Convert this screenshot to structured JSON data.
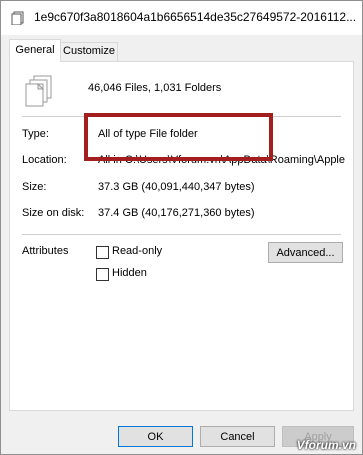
{
  "window": {
    "title": "1e9c670f3a8018604a1b6656514de35c27649572-2016112..."
  },
  "tabs": [
    {
      "label": "General",
      "active": true
    },
    {
      "label": "Customize",
      "active": false
    }
  ],
  "general": {
    "summary": "46,046 Files, 1,031 Folders",
    "type_label": "Type:",
    "type_value": "All of type File folder",
    "location_label": "Location:",
    "location_value": "All in C:\\Users\\Vforum.vn\\AppData\\Roaming\\Apple",
    "size_label": "Size:",
    "size_value": "37.3 GB (40,091,440,347 bytes)",
    "size_on_disk_label": "Size on disk:",
    "size_on_disk_value": "37.4 GB (40,176,271,360 bytes)",
    "attributes_label": "Attributes",
    "readonly_label": "Read-only",
    "hidden_label": "Hidden",
    "advanced_label": "Advanced..."
  },
  "buttons": {
    "ok": "OK",
    "cancel": "Cancel",
    "apply": "Apply"
  },
  "watermark": "Vforum.vn",
  "colors": {
    "highlight_border": "#a31f1f",
    "default_button_border": "#0078d7"
  }
}
